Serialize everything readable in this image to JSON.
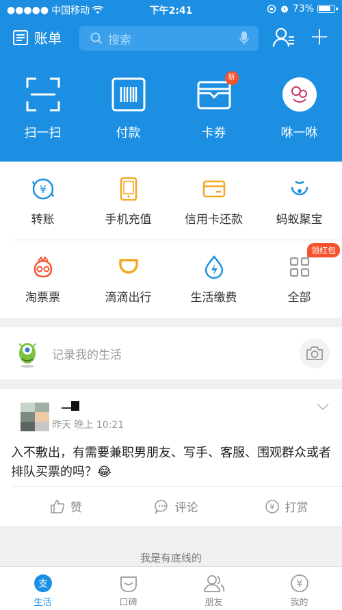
{
  "status": {
    "carrier": "中国移动",
    "time": "下午2:41",
    "battery": "73%"
  },
  "header": {
    "bill_label": "账单",
    "search_placeholder": "搜索"
  },
  "quick": [
    {
      "label": "扫一扫",
      "icon": "scan-icon"
    },
    {
      "label": "付款",
      "icon": "barcode-icon"
    },
    {
      "label": "卡券",
      "icon": "wallet-icon",
      "badge": "新"
    },
    {
      "label": "咻一咻",
      "icon": "xiu-avatar-icon"
    }
  ],
  "services": [
    {
      "label": "转账",
      "icon": "transfer-icon",
      "color": "#1c8fe3"
    },
    {
      "label": "手机充值",
      "icon": "phone-icon",
      "color": "#f5a623"
    },
    {
      "label": "信用卡还款",
      "icon": "credit-card-icon",
      "color": "#f5a623"
    },
    {
      "label": "蚂蚁聚宝",
      "icon": "ant-icon",
      "color": "#1c8fe3"
    },
    {
      "label": "淘票票",
      "icon": "taopiaopiao-icon",
      "color": "#f5532d"
    },
    {
      "label": "滴滴出行",
      "icon": "didi-icon",
      "color": "#f5a623"
    },
    {
      "label": "生活缴费",
      "icon": "utility-icon",
      "color": "#1c8fe3"
    },
    {
      "label": "全部",
      "icon": "grid-icon",
      "color": "#999999",
      "badge": "领红包"
    }
  ],
  "record": {
    "text": "记录我的生活"
  },
  "post": {
    "time": "昨天 晚上 10:21",
    "content": "入不敷出，有需要兼职男朋友、写手、客服、围观群众或者排队买票的吗？😂",
    "like": "赞",
    "comment": "评论",
    "tip": "打赏"
  },
  "bottom_line": "我是有底线的",
  "tabs": [
    {
      "label": "生活",
      "icon": "life-icon",
      "active": true
    },
    {
      "label": "口碑",
      "icon": "koubei-icon",
      "active": false
    },
    {
      "label": "朋友",
      "icon": "friends-icon",
      "active": false
    },
    {
      "label": "我的",
      "icon": "mine-icon",
      "active": false
    }
  ],
  "colors": {
    "brand_blue": "#1c8fe3",
    "badge_red": "#f5532d"
  }
}
